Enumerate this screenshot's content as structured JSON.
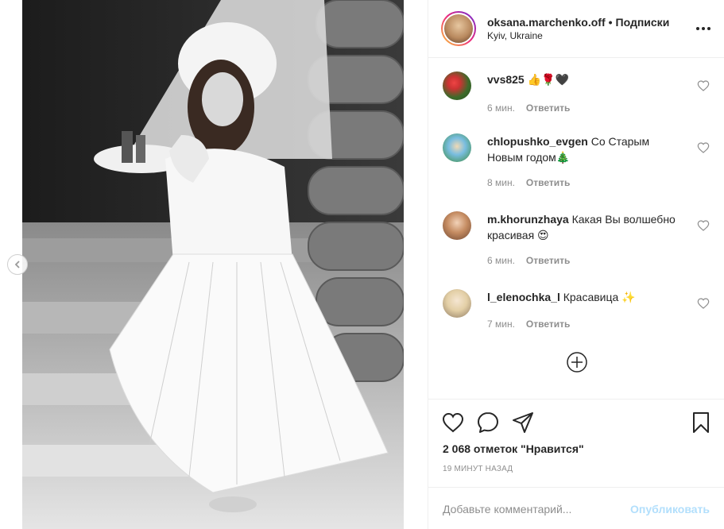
{
  "post": {
    "username": "oksana.marchenko.off",
    "separator": "•",
    "follow_status": "Подписки",
    "location": "Kyiv, Ukraine",
    "avatar_icon": "profile-avatar"
  },
  "comments": [
    {
      "user": "vvs825",
      "text": "👍🌹🖤",
      "time": "6 мин.",
      "reply": "Ответить",
      "avatar_color": "#4a7a3a"
    },
    {
      "user": "chlopushko_evgen",
      "text": "Со Старым Новым годом🎄",
      "time": "8 мин.",
      "reply": "Ответить",
      "avatar_color": "#6fb0d8"
    },
    {
      "user": "m.khorunzhaya",
      "text": "Какая Вы волшебно красивая 😍",
      "time": "6 мин.",
      "reply": "Ответить",
      "avatar_color": "#b07a5a"
    },
    {
      "user": "l_elenochka_l",
      "text": "Красавица ✨",
      "time": "7 мин.",
      "reply": "Ответить",
      "avatar_color": "#d9c9b3"
    }
  ],
  "stats": {
    "likes": "2 068 отметок \"Нравится\"",
    "posted": "19 МИНУТ НАЗАД"
  },
  "composer": {
    "placeholder": "Добавьте комментарий...",
    "post_label": "Опубликовать"
  },
  "colors": {
    "accent_disabled": "#b2dffc",
    "muted": "#8e8e8e",
    "text": "#262626"
  }
}
